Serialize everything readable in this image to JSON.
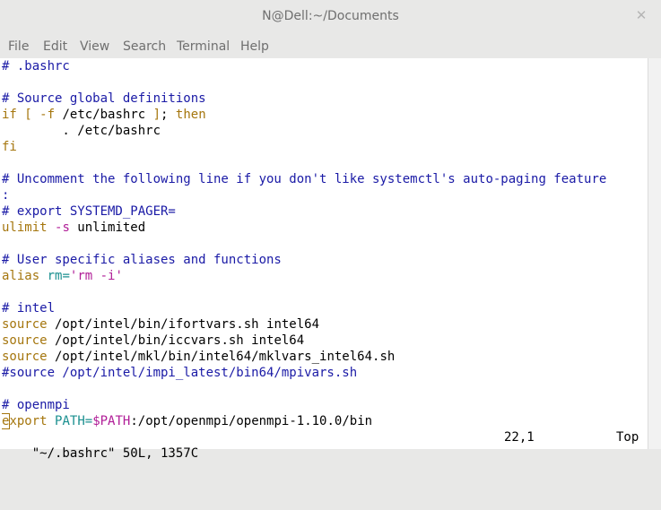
{
  "window": {
    "title": "N@Dell:~/Documents"
  },
  "menu": [
    "File",
    "Edit",
    "View",
    "Search",
    "Terminal",
    "Help"
  ],
  "lines": [
    [
      [
        "c-comment",
        "# .bashrc"
      ]
    ],
    [],
    [
      [
        "c-comment",
        "# Source global definitions"
      ]
    ],
    [
      [
        "c-kw",
        "if"
      ],
      [
        "c-plain",
        " "
      ],
      [
        "c-kw",
        "["
      ],
      [
        "c-plain",
        " "
      ],
      [
        "c-kw",
        "-f"
      ],
      [
        "c-plain",
        " /etc/bashrc "
      ],
      [
        "c-kw",
        "]"
      ],
      [
        "c-plain",
        "; "
      ],
      [
        "c-kw",
        "then"
      ]
    ],
    [
      [
        "c-plain",
        "        . /etc/bashrc"
      ]
    ],
    [
      [
        "c-kw",
        "fi"
      ]
    ],
    [],
    [
      [
        "c-comment",
        "# Uncomment the following line if you don't like systemctl's auto-paging feature"
      ]
    ],
    [
      [
        "c-comment",
        ":"
      ]
    ],
    [
      [
        "c-comment",
        "# export SYSTEMD_PAGER="
      ]
    ],
    [
      [
        "c-kw",
        "ulimit"
      ],
      [
        "c-plain",
        " "
      ],
      [
        "c-str",
        "-s"
      ],
      [
        "c-plain",
        " unlimited"
      ]
    ],
    [],
    [
      [
        "c-comment",
        "# User specific aliases and functions"
      ]
    ],
    [
      [
        "c-kw",
        "alias"
      ],
      [
        "c-plain",
        " "
      ],
      [
        "c-var",
        "rm="
      ],
      [
        "c-str",
        "'rm -i'"
      ]
    ],
    [],
    [
      [
        "c-comment",
        "# intel"
      ]
    ],
    [
      [
        "c-kw",
        "source"
      ],
      [
        "c-plain",
        " /opt/intel/bin/ifortvars.sh intel64"
      ]
    ],
    [
      [
        "c-kw",
        "source"
      ],
      [
        "c-plain",
        " /opt/intel/bin/iccvars.sh intel64"
      ]
    ],
    [
      [
        "c-kw",
        "source"
      ],
      [
        "c-plain",
        " /opt/intel/mkl/bin/intel64/mklvars_intel64.sh"
      ]
    ],
    [
      [
        "c-comment",
        "#source /opt/intel/impi_latest/bin64/mpivars.sh"
      ]
    ],
    [],
    [
      [
        "c-comment",
        "# openmpi"
      ]
    ],
    [
      [
        "c-kw",
        "export"
      ],
      [
        "c-plain",
        " "
      ],
      [
        "c-var",
        "PATH="
      ],
      [
        "c-str",
        "$PATH"
      ],
      [
        "c-plain",
        ":/opt/openmpi/openmpi-1.10.0/bin"
      ]
    ]
  ],
  "status": {
    "file": "\"~/.bashrc\" 50L, 1357C",
    "position": "22,1",
    "scroll": "Top"
  },
  "colors": {
    "comment": "#1a1aa6",
    "keyword": "#a5760e",
    "string": "#b01d97",
    "variable": "#1a8f8f"
  }
}
